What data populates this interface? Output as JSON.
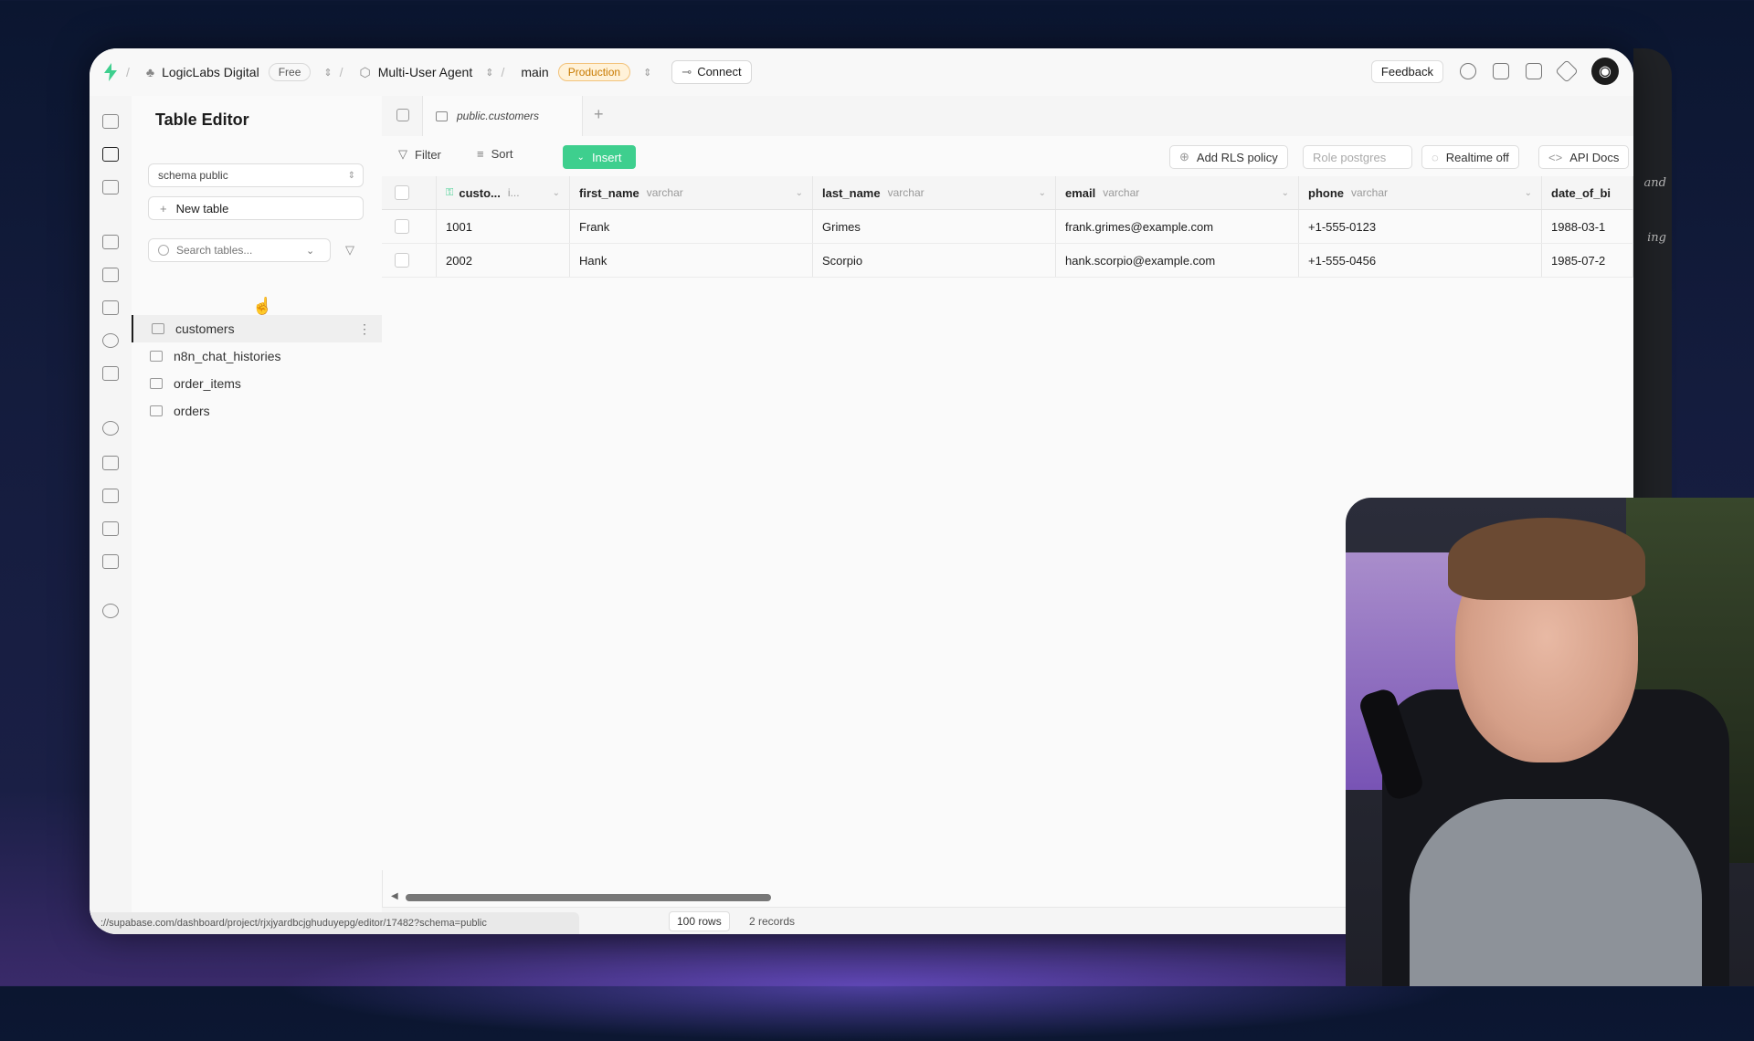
{
  "topbar": {
    "org": "LogicLabs Digital",
    "plan": "Free",
    "project": "Multi-User Agent",
    "branch": "main",
    "env": "Production",
    "connect": "Connect",
    "feedback": "Feedback"
  },
  "panel": {
    "title": "Table Editor",
    "schema": "schema public",
    "new_table": "New table",
    "search_placeholder": "Search tables...",
    "tables": [
      "customers",
      "n8n_chat_histories",
      "order_items",
      "orders"
    ]
  },
  "tab": {
    "label": "public.customers"
  },
  "toolbar": {
    "filter": "Filter",
    "sort": "Sort",
    "insert": "Insert",
    "add_rls": "Add RLS policy",
    "role": "Role postgres",
    "realtime": "Realtime off",
    "api_docs": "API Docs"
  },
  "grid": {
    "columns": [
      {
        "name": "custo...",
        "type": "i..."
      },
      {
        "name": "first_name",
        "type": "varchar"
      },
      {
        "name": "last_name",
        "type": "varchar"
      },
      {
        "name": "email",
        "type": "varchar"
      },
      {
        "name": "phone",
        "type": "varchar"
      },
      {
        "name": "date_of_bi",
        "type": ""
      }
    ],
    "rows": [
      [
        "1001",
        "Frank",
        "Grimes",
        "frank.grimes@example.com",
        "+1-555-0123",
        "1988-03-1"
      ],
      [
        "2002",
        "Hank",
        "Scorpio",
        "hank.scorpio@example.com",
        "+1-555-0456",
        "1985-07-2"
      ]
    ]
  },
  "footer": {
    "rows": "100 rows",
    "records": "2 records",
    "url": "://supabase.com/dashboard/project/rjxjyardbcjghuduyepg/editor/17482?schema=public"
  },
  "side_text": [
    "and",
    "ing"
  ]
}
